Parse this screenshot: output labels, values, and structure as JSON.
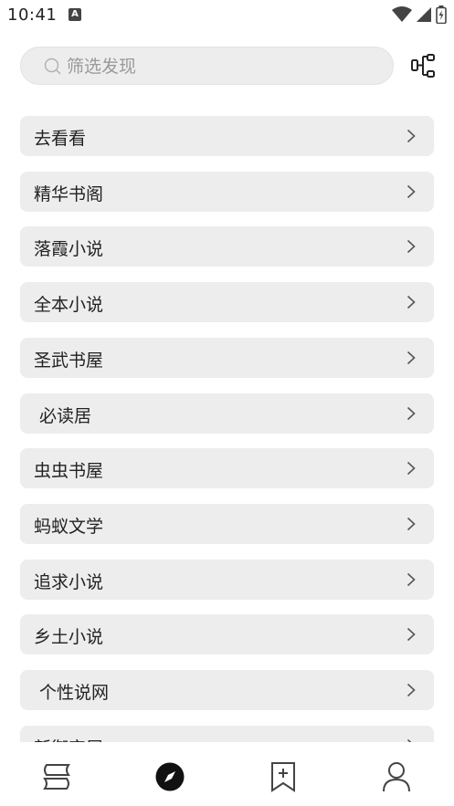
{
  "status_bar": {
    "time": "10:41",
    "notification_icon": "A"
  },
  "search": {
    "placeholder": "筛选发现"
  },
  "sources": [
    {
      "label": "去看看"
    },
    {
      "label": "精华书阁"
    },
    {
      "label": "落霞小说"
    },
    {
      "label": "全本小说"
    },
    {
      "label": "圣武书屋"
    },
    {
      "label": " 必读居"
    },
    {
      "label": "虫虫书屋"
    },
    {
      "label": "蚂蚁文学"
    },
    {
      "label": "追求小说"
    },
    {
      "label": "乡土小说"
    },
    {
      "label": " 个性说网"
    },
    {
      "label": "新御宅屋"
    }
  ],
  "bottom_nav": {
    "items": [
      {
        "icon": "bookshelf-icon"
      },
      {
        "icon": "compass-icon",
        "active": true
      },
      {
        "icon": "bookmark-add-icon"
      },
      {
        "icon": "person-icon"
      }
    ]
  },
  "colors": {
    "item_bg": "#ededed",
    "text": "#222222",
    "icon": "#444444"
  }
}
